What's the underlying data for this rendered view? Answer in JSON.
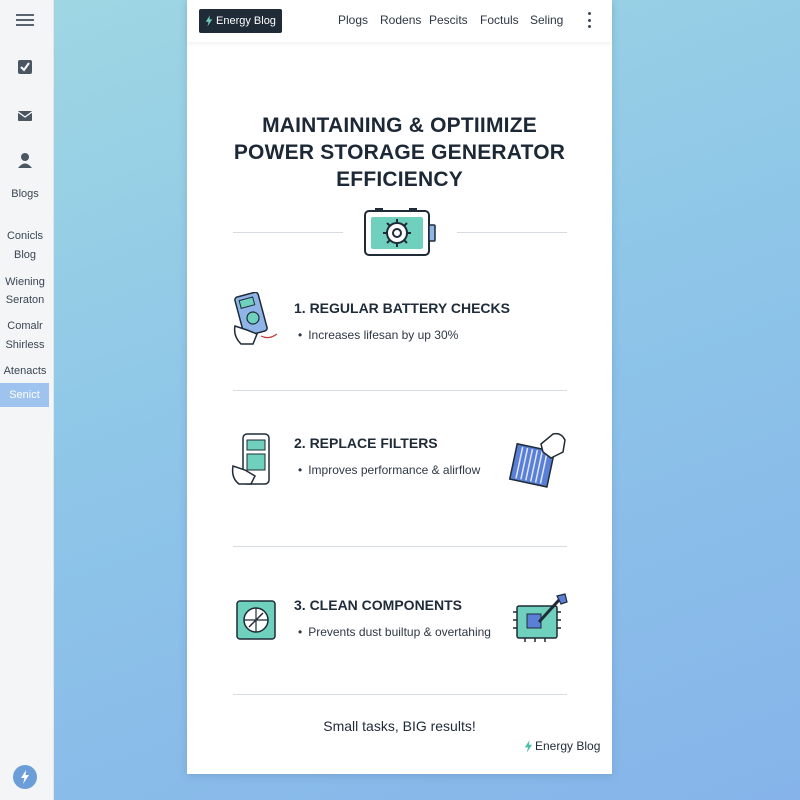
{
  "sidebar": {
    "items": [
      "Blogs",
      "Conicls",
      "Blog",
      "Wiening",
      "Seraton",
      "Comalr",
      "Shirless",
      "Atenacts"
    ],
    "active_item": "Senict",
    "icons": [
      "menu-icon",
      "check-square-icon",
      "mail-icon",
      "user-icon",
      "bolt-icon"
    ]
  },
  "header": {
    "brand": "Energy Blog",
    "nav": [
      "Plogs",
      "Rodens",
      "Pescits",
      "Foctuls",
      "Seling"
    ]
  },
  "article": {
    "title_lines": [
      "MAINTAINING & OPTIIMIZE",
      "POWER STORAGE GENERATOR",
      "EFFICIENCY"
    ],
    "sections": [
      {
        "heading": "1. REGULAR BATTERY CHECKS",
        "bullet": "Increases lifesan by up 30%"
      },
      {
        "heading": "2. REPLACE FILTERS",
        "bullet": "Improves performance & alirflow"
      },
      {
        "heading": "3. CLEAN COMPONENTS",
        "bullet": "Prevents dust builtup & overtahing"
      }
    ],
    "tagline": "Small tasks, BIG results!",
    "footer_brand": "Energy Blog"
  },
  "colors": {
    "accent_teal": "#6fd0be",
    "accent_blue": "#5a7fd6",
    "dark": "#1f2b37",
    "active_sidebar": "#9ec3ee"
  }
}
